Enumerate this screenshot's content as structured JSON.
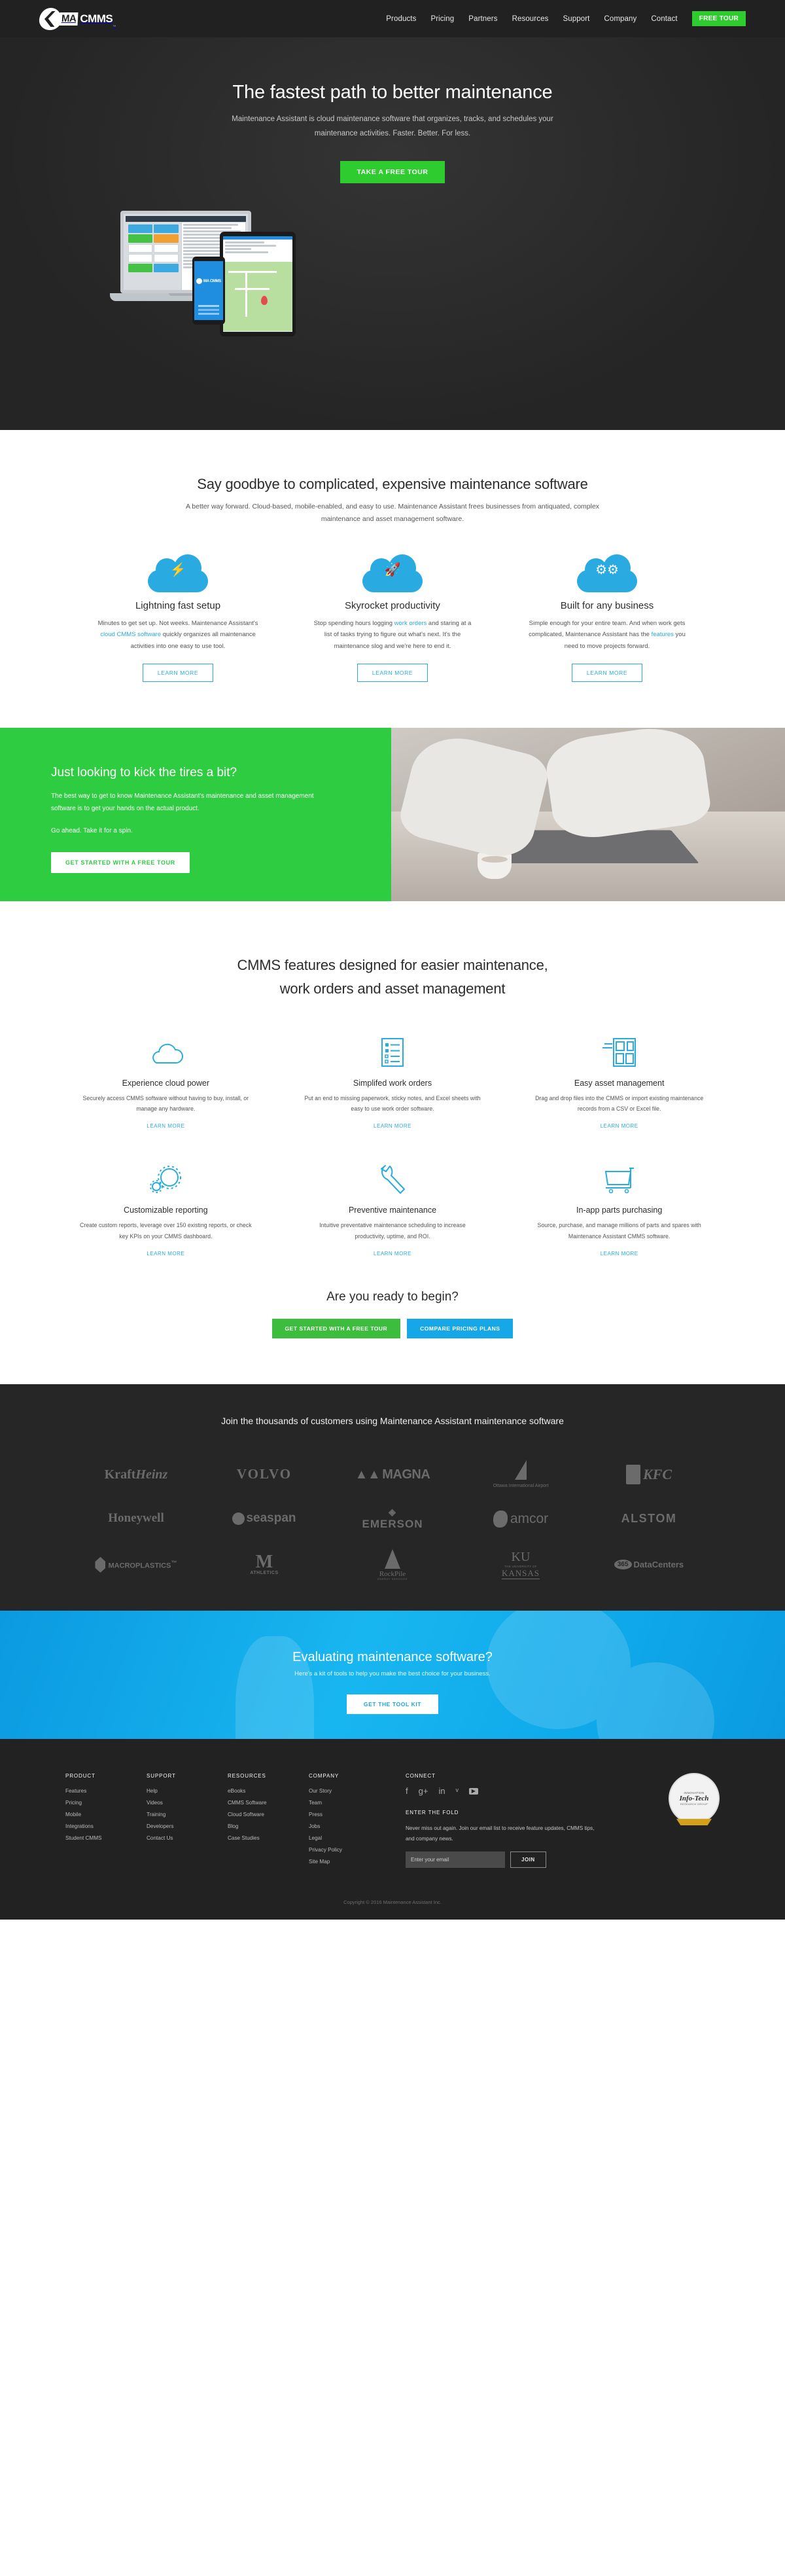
{
  "header": {
    "logo": {
      "mark": "ma-logo-icon",
      "ma": "MA",
      "cmms": "CMMS",
      "tm": "™"
    },
    "nav": [
      {
        "label": "Products"
      },
      {
        "label": "Pricing"
      },
      {
        "label": "Partners"
      },
      {
        "label": "Resources"
      },
      {
        "label": "Support"
      },
      {
        "label": "Company"
      },
      {
        "label": "Contact"
      }
    ],
    "cta": "FREE TOUR"
  },
  "hero": {
    "title": "The fastest path to better maintenance",
    "subtitle": "Maintenance Assistant is cloud maintenance software that organizes, tracks, and schedules your maintenance activities. Faster. Better. For less.",
    "cta": "TAKE A FREE TOUR"
  },
  "goodbye": {
    "title": "Say goodbye to complicated, expensive maintenance software",
    "subtitle": "A better way forward. Cloud-based, mobile-enabled, and easy to use. Maintenance Assistant frees businesses from antiquated, complex maintenance and asset management software.",
    "columns": [
      {
        "icon": "cloud-lightning-icon",
        "title": "Lightning fast setup",
        "body_1": "Minutes to get set up. Not weeks. Maintenance Assistant's ",
        "link": "cloud CMMS software",
        "body_2": " quickly organizes all maintenance activities into one easy to use tool.",
        "cta": "LEARN MORE"
      },
      {
        "icon": "cloud-rocket-icon",
        "title": "Skyrocket productivity",
        "body_1": "Stop spending hours logging ",
        "link": "work orders",
        "body_2": " and staring at a list of tasks trying to figure out what's next. It's the maintenance slog and we're here to end it.",
        "cta": "LEARN MORE"
      },
      {
        "icon": "cloud-gears-icon",
        "title": "Built for any business",
        "body_1": "Simple enough for your entire team. And when work gets complicated, Maintenance Assistant has the ",
        "link": "features",
        "body_2": " you need to move projects forward.",
        "cta": "LEARN MORE"
      }
    ]
  },
  "tires": {
    "title": "Just looking to kick the tires a bit?",
    "body": "The best way to get to know Maintenance Assistant's maintenance and asset management software is to get your hands on the actual product.",
    "body2": "Go ahead. Take it for a spin.",
    "cta": "GET STARTED WITH A FREE TOUR"
  },
  "features": {
    "title_line1": "CMMS features designed for easier maintenance,",
    "title_line2": "work orders and asset management",
    "items": [
      {
        "icon": "cloud-outline-icon",
        "title": "Experience cloud power",
        "body": "Securely access CMMS software without having to buy, install, or manage any hardware.",
        "cta": "LEARN MORE"
      },
      {
        "icon": "checklist-icon",
        "title": "Simplifed work orders",
        "body": "Put an end to missing paperwork, sticky notes, and Excel sheets with easy to use work order software.",
        "cta": "LEARN MORE"
      },
      {
        "icon": "asset-grid-icon",
        "title": "Easy asset management",
        "body": "Drag and drop files into the CMMS or import existing maintenance records from a CSV or Excel file.",
        "cta": "LEARN MORE"
      },
      {
        "icon": "gears-icon",
        "title": "Customizable reporting",
        "body": "Create custom reports, leverage over 150 existing reports, or check key KPIs on your CMMS dashboard.",
        "cta": "LEARN MORE"
      },
      {
        "icon": "wrench-icon",
        "title": "Preventive maintenance",
        "body": "Intuitive preventative maintenance scheduling to increase productivity, uptime, and ROI.",
        "cta": "LEARN MORE"
      },
      {
        "icon": "shopping-cart-icon",
        "title": "In-app parts purchasing",
        "body": "Source, purchase, and manage millions of parts and spares with Maintenance Assistant CMMS software.",
        "cta": "LEARN MORE"
      }
    ]
  },
  "ready": {
    "title": "Are you ready to begin?",
    "cta_primary": "GET STARTED WITH A FREE TOUR",
    "cta_secondary": "COMPARE PRICING PLANS"
  },
  "customers": {
    "title": "Join the thousands of customers using Maintenance Assistant maintenance software",
    "logos": [
      {
        "name": "Kraft Heinz",
        "part1": "Kraft",
        "part2": "Heinz"
      },
      {
        "name": "VOLVO"
      },
      {
        "name": "MAGNA"
      },
      {
        "name": "Ottawa International Airport"
      },
      {
        "name": "KFC"
      },
      {
        "name": "Honeywell"
      },
      {
        "name": "seaspan"
      },
      {
        "name": "EMERSON"
      },
      {
        "name": "amcor"
      },
      {
        "name": "ALSTOM"
      },
      {
        "name": "MACROPLASTICS",
        "part1": "MACRO",
        "part2": "PLASTICS",
        "tm": "™"
      },
      {
        "name": "M ATHLETICS",
        "part1": "M",
        "part2": "ATHLETICS"
      },
      {
        "name": "RockPile Energy Services",
        "part1": "RockPile",
        "part2": "ENERGY SERVICES"
      },
      {
        "name": "The University of Kansas",
        "part1": "KU",
        "part2": "THE UNIVERSITY OF",
        "part3": "KANSAS"
      },
      {
        "name": "365 DataCenters",
        "part1": "365",
        "part2": "DataCenters"
      }
    ]
  },
  "evaluating": {
    "title": "Evaluating maintenance software?",
    "subtitle": "Here's a kit of tools to help you make the best choice for your business.",
    "cta": "GET THE TOOL KIT"
  },
  "footer": {
    "columns": [
      {
        "heading": "PRODUCT",
        "links": [
          "Features",
          "Pricing",
          "Mobile",
          "Integrations",
          "Student CMMS"
        ]
      },
      {
        "heading": "SUPPORT",
        "links": [
          "Help",
          "Videos",
          "Training",
          "Developers",
          "Contact Us"
        ]
      },
      {
        "heading": "RESOURCES",
        "links": [
          "eBooks",
          "CMMS Software",
          "Cloud Software",
          "Blog",
          "Case Studies"
        ]
      },
      {
        "heading": "COMPANY",
        "links": [
          "Our Story",
          "Team",
          "Press",
          "Jobs",
          "Legal",
          "Privacy Policy",
          "Site Map"
        ]
      }
    ],
    "connect": {
      "heading": "CONNECT",
      "socials": [
        {
          "name": "facebook-icon",
          "glyph": "f"
        },
        {
          "name": "google-plus-icon",
          "glyph": "g+"
        },
        {
          "name": "linkedin-icon",
          "glyph": "in"
        },
        {
          "name": "twitter-icon",
          "glyph": "ᵛ"
        },
        {
          "name": "youtube-icon",
          "glyph": "▶"
        }
      ]
    },
    "fold": {
      "heading": "ENTER THE FOLD",
      "description": "Never miss out again. Join our email list to receive feature updates, CMMS tips, and company news.",
      "placeholder": "Enter your email",
      "button": "JOIN"
    },
    "badge": {
      "top": "INNOVATION",
      "mid": "Info-Tech",
      "bot": "RESEARCH GROUP"
    },
    "copyright": "Copyright © 2016 Maintenance Assistant Inc."
  },
  "colors": {
    "green": "#2ecc40",
    "blue": "#29abe2",
    "dark": "#212121",
    "dark_alt": "#262626"
  }
}
